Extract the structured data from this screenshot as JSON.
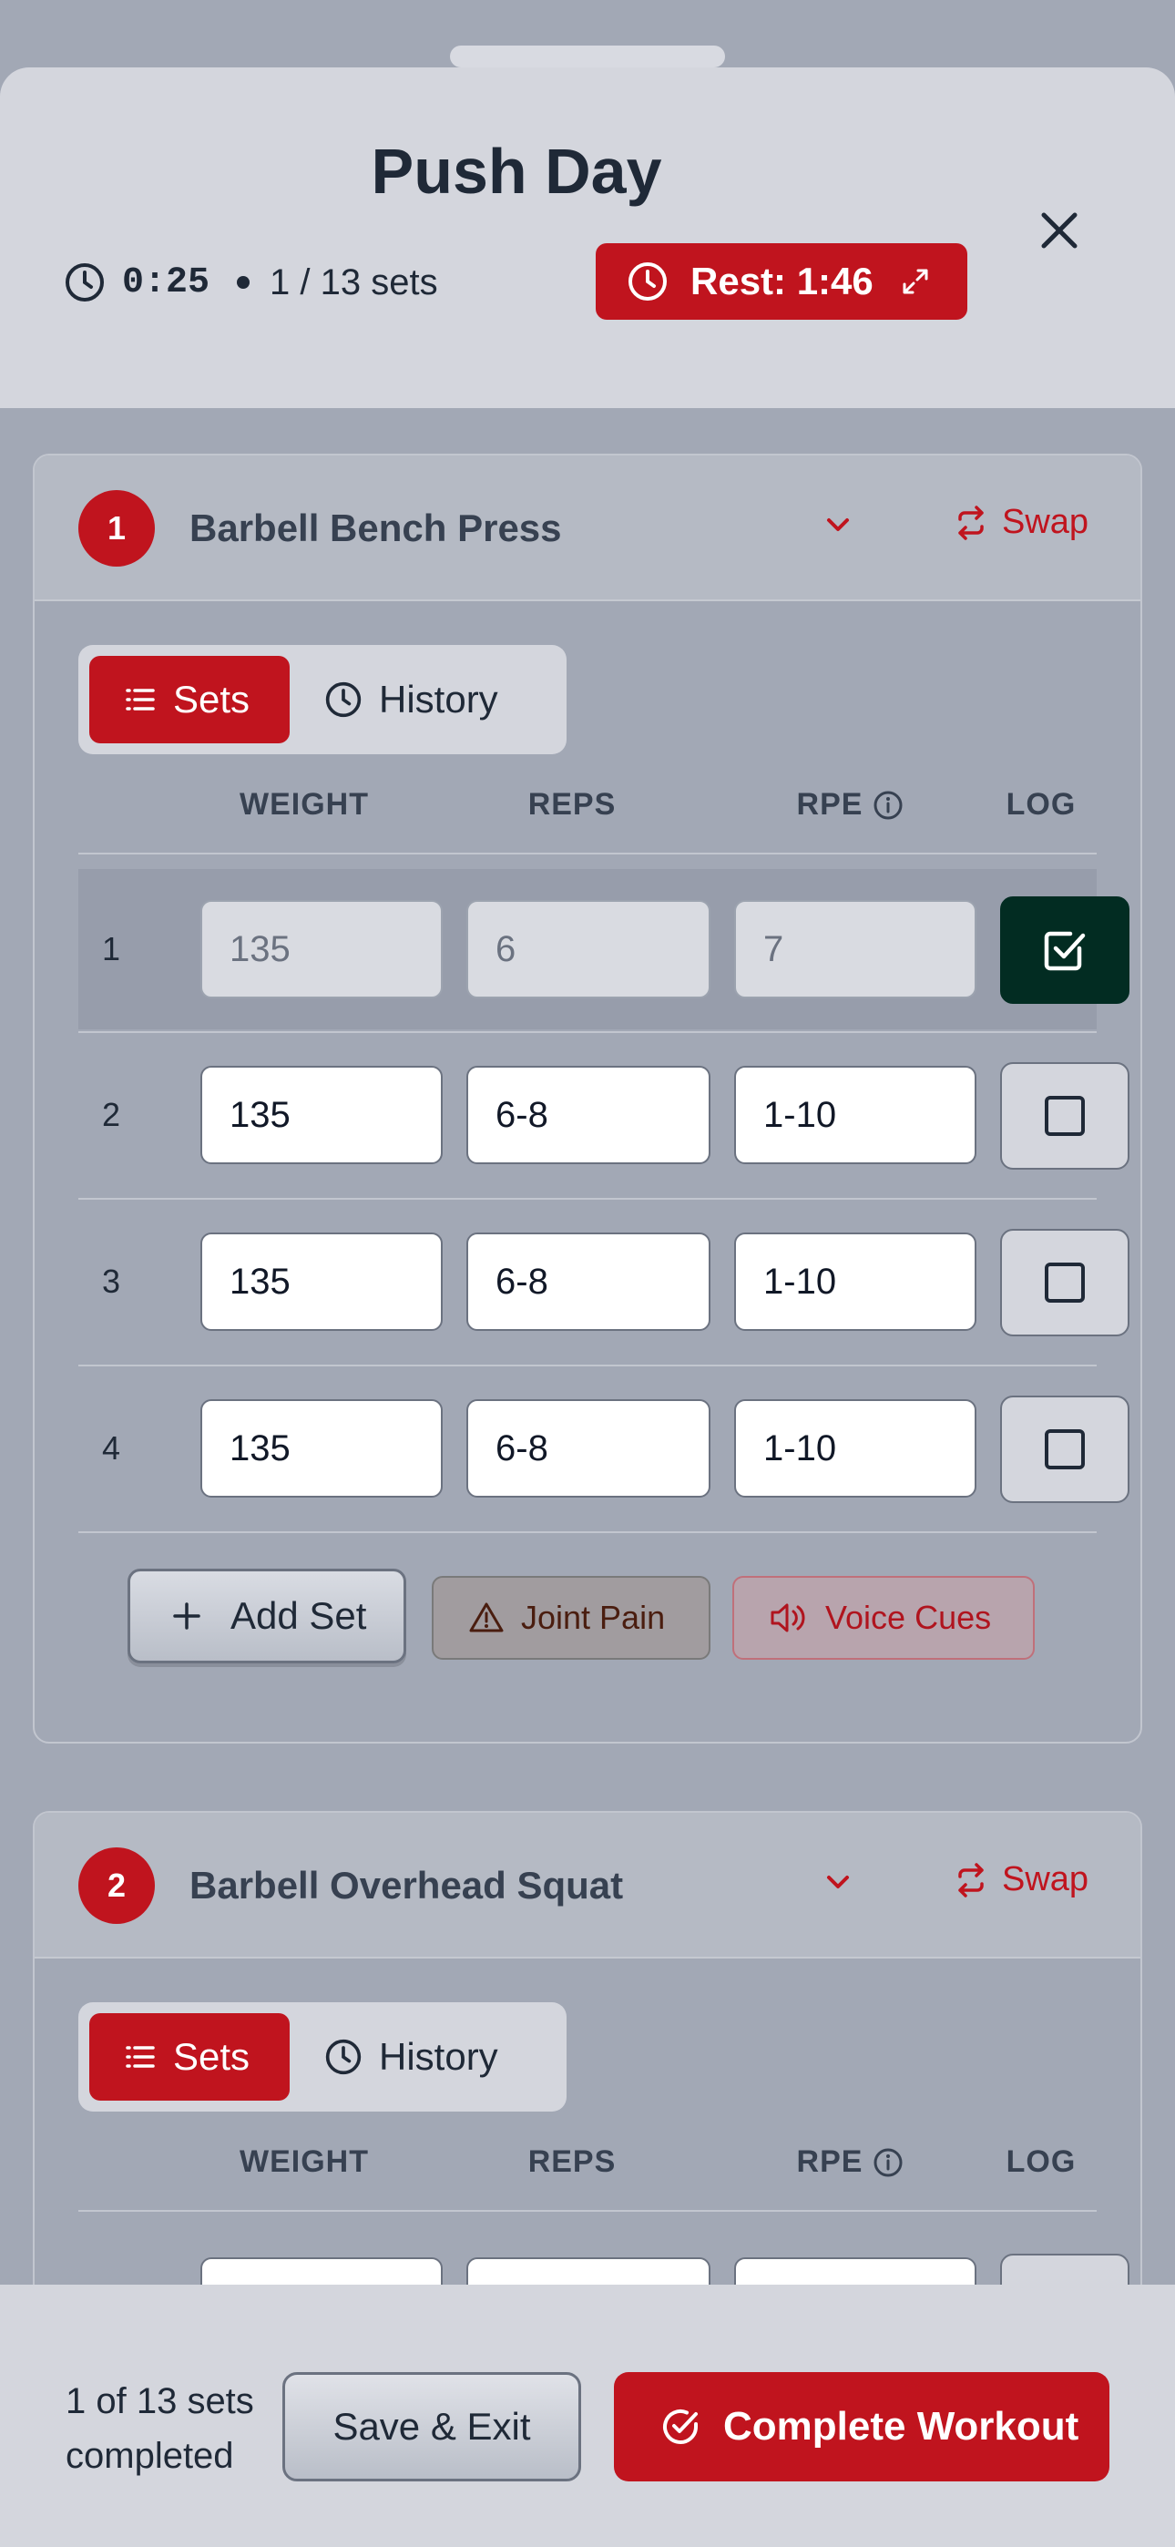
{
  "header": {
    "title": "Push Day",
    "elapsed": "0:25",
    "sets_progress": "1 / 13 sets",
    "rest_label": "Rest: 1:46",
    "icons": {
      "timer": "clock-icon",
      "close": "close-icon",
      "expand": "expand-icon"
    }
  },
  "exercises": [
    {
      "number": "1",
      "name": "Barbell Bench Press",
      "swap_label": "Swap",
      "tabs": {
        "sets": "Sets",
        "history": "History"
      },
      "columns": {
        "weight": "WEIGHT",
        "reps": "REPS",
        "rpe": "RPE",
        "log": "LOG"
      },
      "sets": [
        {
          "num": "1",
          "weight": "135",
          "reps": "6",
          "rpe": "7",
          "logged": true
        },
        {
          "num": "2",
          "weight": "135",
          "reps": "6-8",
          "rpe": "1-10",
          "logged": false
        },
        {
          "num": "3",
          "weight": "135",
          "reps": "6-8",
          "rpe": "1-10",
          "logged": false
        },
        {
          "num": "4",
          "weight": "135",
          "reps": "6-8",
          "rpe": "1-10",
          "logged": false
        }
      ],
      "actions": {
        "add_set": "Add Set",
        "joint_pain": "Joint Pain",
        "voice_cues": "Voice Cues"
      }
    },
    {
      "number": "2",
      "name": "Barbell Overhead Squat",
      "swap_label": "Swap",
      "tabs": {
        "sets": "Sets",
        "history": "History"
      },
      "columns": {
        "weight": "WEIGHT",
        "reps": "REPS",
        "rpe": "RPE",
        "log": "LOG"
      }
    }
  ],
  "footer": {
    "progress_text": "1 of 13 sets completed",
    "save_exit": "Save & Exit",
    "complete": "Complete Workout"
  },
  "colors": {
    "accent": "#c0141e",
    "logged": "#022c22",
    "sheet": "#d4d6dd",
    "backdrop": "#a2a8b5"
  }
}
